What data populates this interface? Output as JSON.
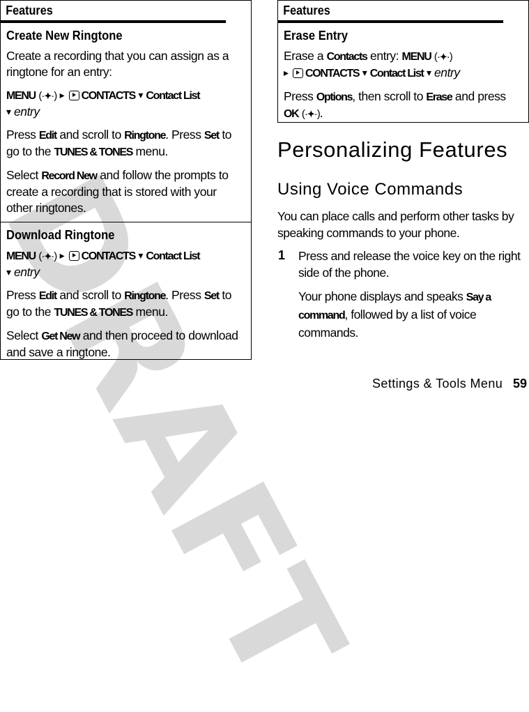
{
  "watermark": "DRAFT",
  "left_table": {
    "header": "Features",
    "rows": [
      {
        "title": "Create New Ringtone",
        "intro": "Create a recording that you can assign as a ringtone for an entry:",
        "path": {
          "menu": "MENU",
          "contacts": "CONTACTS",
          "contact_list": "Contact List",
          "entry": "entry"
        },
        "p2": {
          "t1": "Press ",
          "k1": "Edit",
          "t2": " and scroll to ",
          "k2": "Ringtone",
          "t3": ". Press ",
          "k3": "Set",
          "t4": " to go to the ",
          "k4": "TUNES & TONES",
          "t5": " menu."
        },
        "p3": {
          "t1": "Select ",
          "k1": "Record New",
          "t2": " and follow the prompts to create a recording that is stored with your other ringtones."
        }
      },
      {
        "title": "Download Ringtone",
        "path": {
          "menu": "MENU",
          "contacts": "CONTACTS",
          "contact_list": "Contact List",
          "entry": "entry"
        },
        "p2": {
          "t1": "Press ",
          "k1": "Edit",
          "t2": " and scroll to ",
          "k2": "Ringtone",
          "t3": ". Press ",
          "k3": "Set",
          "t4": " to go to the ",
          "k4": "TUNES & TONES",
          "t5": " menu."
        },
        "p3": {
          "t1": "Select ",
          "k1": "Get New",
          "t2": " and then proceed to download and save a ringtone."
        }
      }
    ]
  },
  "right_table": {
    "header": "Features",
    "rows": [
      {
        "title": "Erase Entry",
        "p1": {
          "t1": "Erase a ",
          "k1": "Contacts",
          "t2": " entry: ",
          "menu": "MENU",
          "contacts": "CONTACTS",
          "contact_list": "Contact List",
          "entry": "entry"
        },
        "p2": {
          "t1": "Press ",
          "k1": "Options",
          "t2": ", then scroll to ",
          "k2": "Erase",
          "t3": " and press ",
          "k3": "OK",
          "t4": "."
        }
      }
    ]
  },
  "section": {
    "title": "Personalizing Features",
    "subtitle": "Using Voice Commands",
    "intro": "You can place calls and perform other tasks by speaking commands to your phone.",
    "steps": [
      {
        "number": "1",
        "text": "Press and release the voice key on the right side of the phone.",
        "detail": {
          "t1": "Your phone displays and speaks ",
          "k1": "Say a command",
          "t2": ", followed by a list of voice commands."
        }
      }
    ]
  },
  "footer": {
    "section_name": "Settings & Tools Menu",
    "page_number": "59"
  },
  "icons": {
    "nav_key": "(·✦·)",
    "arrow_right": "▸",
    "arrow_down": "▾"
  }
}
